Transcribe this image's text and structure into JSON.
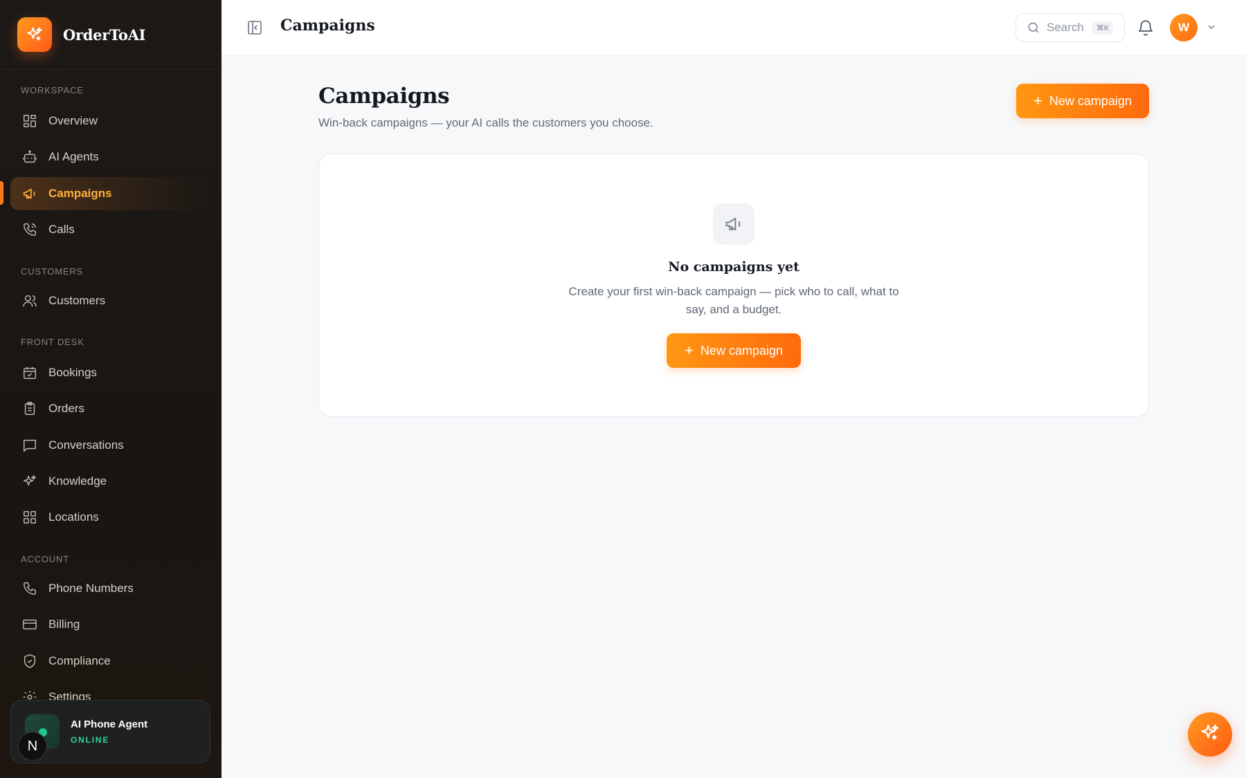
{
  "brand": {
    "name": "OrderToAI",
    "logo_icon": "sparkles-icon",
    "accent": "#ff7a1a"
  },
  "sidebar": {
    "sections": {
      "workspace": "WORKSPACE",
      "customers": "CUSTOMERS",
      "front_desk": "FRONT DESK",
      "account": "ACCOUNT"
    },
    "items": [
      {
        "label": "Overview",
        "icon": "grid-icon"
      },
      {
        "label": "AI Agents",
        "icon": "robot-icon"
      },
      {
        "label": "Campaigns",
        "icon": "megaphone-icon",
        "active": true
      },
      {
        "label": "Calls",
        "icon": "phone-call-icon"
      },
      {
        "label": "Customers",
        "icon": "users-icon"
      },
      {
        "label": "Bookings",
        "icon": "calendar-icon"
      },
      {
        "label": "Orders",
        "icon": "clipboard-icon"
      },
      {
        "label": "Conversations",
        "icon": "chat-icon"
      },
      {
        "label": "Knowledge",
        "icon": "sparkles-icon"
      },
      {
        "label": "Locations",
        "icon": "grid-icon"
      },
      {
        "label": "Phone Numbers",
        "icon": "phone-icon"
      },
      {
        "label": "Billing",
        "icon": "credit-card-icon"
      },
      {
        "label": "Compliance",
        "icon": "shield-check-icon"
      },
      {
        "label": "Settings",
        "icon": "gear-icon"
      }
    ],
    "agent_card": {
      "title": "AI Phone Agent",
      "status": "ONLINE",
      "status_color": "#2fd39a"
    },
    "n_badge": "N"
  },
  "topbar": {
    "title": "Campaigns",
    "search_placeholder": "Search",
    "search_shortcut": "⌘K",
    "avatar_initial": "W"
  },
  "main": {
    "title": "Campaigns",
    "subtitle": "Win-back campaigns — your AI calls the customers you choose.",
    "new_campaign_label": "New campaign",
    "empty_state": {
      "title": "No campaigns yet",
      "description": "Create your first win-back campaign — pick who to call, what to say, and a budget.",
      "button_label": "New campaign"
    }
  }
}
